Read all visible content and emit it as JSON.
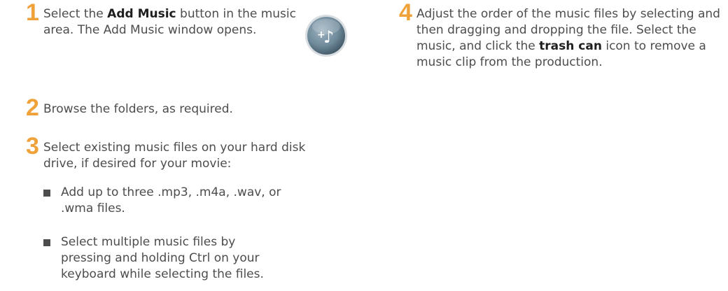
{
  "steps": [
    {
      "number": "1",
      "pre": "Select the ",
      "bold": "Add Music",
      "post": " button in the music area. The Add Music window opens."
    },
    {
      "number": "2",
      "text": "Browse the folders, as required."
    },
    {
      "number": "3",
      "text": "Select existing music files on your hard disk drive, if desired for your movie:",
      "bullets": [
        "Add up to three .mp3, .m4a, .wav, or .wma files.",
        "Select multiple music files by pressing and holding Ctrl on your keyboard while selecting the files."
      ]
    },
    {
      "number": "4",
      "pre": "Adjust the order of the music files by selecting and then dragging and dropping the file. Select the music, and click the ",
      "bold": "trash can",
      "post": " icon to remove a music clip from the production."
    }
  ],
  "icon": {
    "name": "add-music-icon",
    "symbol": "+♪",
    "color": "#6f8a9b"
  }
}
